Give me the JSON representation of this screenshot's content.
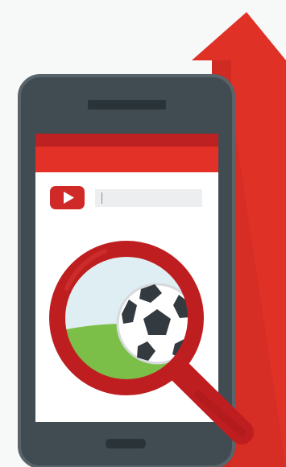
{
  "illustration": {
    "subject": "mobile-video-search-growth",
    "icons": [
      "up-arrow-icon",
      "play-button-icon",
      "magnifying-glass-icon",
      "soccer-ball-icon"
    ],
    "search": {
      "value": ""
    },
    "colors": {
      "background": "#f7f8f8",
      "arrow": "#e03127",
      "arrow_shadow": "#c92a22",
      "phone_body": "#414c52",
      "phone_border": "#58646a",
      "screen": "#ffffff",
      "header_dark": "#bd2121",
      "header": "#e33127",
      "play_button": "#cf2a27",
      "search_field": "#eceeef",
      "magnifier": "#bf1e20",
      "sky": "#dfeef3",
      "grass": "#7bbf49",
      "ball_dark": "#343b40"
    }
  }
}
